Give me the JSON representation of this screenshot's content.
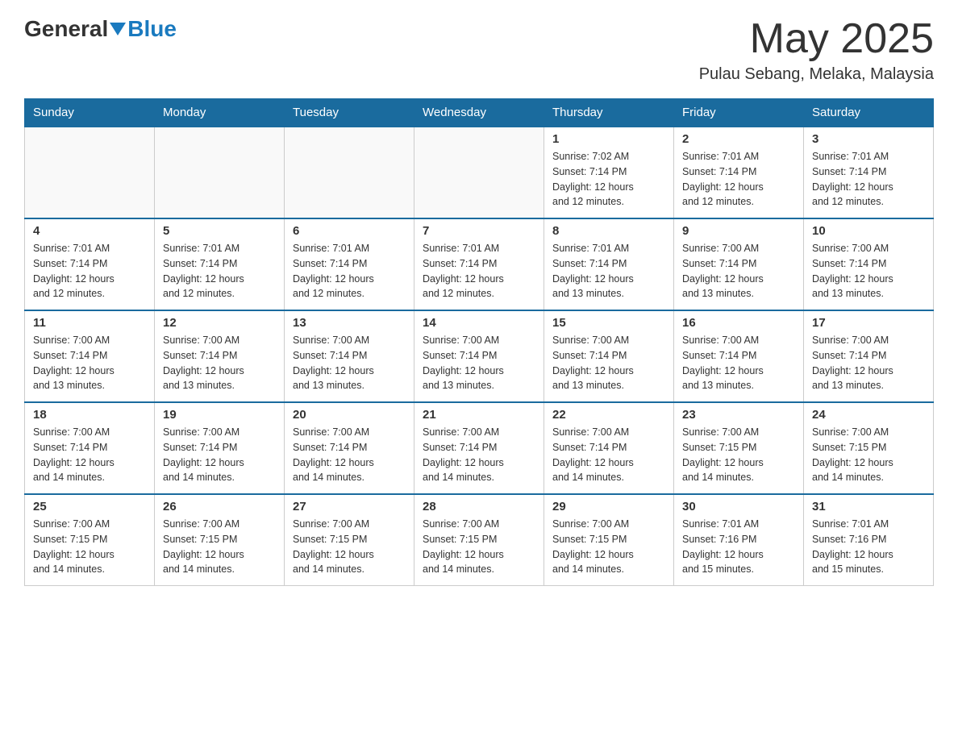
{
  "header": {
    "logo_general": "General",
    "logo_blue": "Blue",
    "month_year": "May 2025",
    "location": "Pulau Sebang, Melaka, Malaysia"
  },
  "days_of_week": [
    "Sunday",
    "Monday",
    "Tuesday",
    "Wednesday",
    "Thursday",
    "Friday",
    "Saturday"
  ],
  "weeks": [
    [
      {
        "day": "",
        "info": ""
      },
      {
        "day": "",
        "info": ""
      },
      {
        "day": "",
        "info": ""
      },
      {
        "day": "",
        "info": ""
      },
      {
        "day": "1",
        "info": "Sunrise: 7:02 AM\nSunset: 7:14 PM\nDaylight: 12 hours\nand 12 minutes."
      },
      {
        "day": "2",
        "info": "Sunrise: 7:01 AM\nSunset: 7:14 PM\nDaylight: 12 hours\nand 12 minutes."
      },
      {
        "day": "3",
        "info": "Sunrise: 7:01 AM\nSunset: 7:14 PM\nDaylight: 12 hours\nand 12 minutes."
      }
    ],
    [
      {
        "day": "4",
        "info": "Sunrise: 7:01 AM\nSunset: 7:14 PM\nDaylight: 12 hours\nand 12 minutes."
      },
      {
        "day": "5",
        "info": "Sunrise: 7:01 AM\nSunset: 7:14 PM\nDaylight: 12 hours\nand 12 minutes."
      },
      {
        "day": "6",
        "info": "Sunrise: 7:01 AM\nSunset: 7:14 PM\nDaylight: 12 hours\nand 12 minutes."
      },
      {
        "day": "7",
        "info": "Sunrise: 7:01 AM\nSunset: 7:14 PM\nDaylight: 12 hours\nand 12 minutes."
      },
      {
        "day": "8",
        "info": "Sunrise: 7:01 AM\nSunset: 7:14 PM\nDaylight: 12 hours\nand 13 minutes."
      },
      {
        "day": "9",
        "info": "Sunrise: 7:00 AM\nSunset: 7:14 PM\nDaylight: 12 hours\nand 13 minutes."
      },
      {
        "day": "10",
        "info": "Sunrise: 7:00 AM\nSunset: 7:14 PM\nDaylight: 12 hours\nand 13 minutes."
      }
    ],
    [
      {
        "day": "11",
        "info": "Sunrise: 7:00 AM\nSunset: 7:14 PM\nDaylight: 12 hours\nand 13 minutes."
      },
      {
        "day": "12",
        "info": "Sunrise: 7:00 AM\nSunset: 7:14 PM\nDaylight: 12 hours\nand 13 minutes."
      },
      {
        "day": "13",
        "info": "Sunrise: 7:00 AM\nSunset: 7:14 PM\nDaylight: 12 hours\nand 13 minutes."
      },
      {
        "day": "14",
        "info": "Sunrise: 7:00 AM\nSunset: 7:14 PM\nDaylight: 12 hours\nand 13 minutes."
      },
      {
        "day": "15",
        "info": "Sunrise: 7:00 AM\nSunset: 7:14 PM\nDaylight: 12 hours\nand 13 minutes."
      },
      {
        "day": "16",
        "info": "Sunrise: 7:00 AM\nSunset: 7:14 PM\nDaylight: 12 hours\nand 13 minutes."
      },
      {
        "day": "17",
        "info": "Sunrise: 7:00 AM\nSunset: 7:14 PM\nDaylight: 12 hours\nand 13 minutes."
      }
    ],
    [
      {
        "day": "18",
        "info": "Sunrise: 7:00 AM\nSunset: 7:14 PM\nDaylight: 12 hours\nand 14 minutes."
      },
      {
        "day": "19",
        "info": "Sunrise: 7:00 AM\nSunset: 7:14 PM\nDaylight: 12 hours\nand 14 minutes."
      },
      {
        "day": "20",
        "info": "Sunrise: 7:00 AM\nSunset: 7:14 PM\nDaylight: 12 hours\nand 14 minutes."
      },
      {
        "day": "21",
        "info": "Sunrise: 7:00 AM\nSunset: 7:14 PM\nDaylight: 12 hours\nand 14 minutes."
      },
      {
        "day": "22",
        "info": "Sunrise: 7:00 AM\nSunset: 7:14 PM\nDaylight: 12 hours\nand 14 minutes."
      },
      {
        "day": "23",
        "info": "Sunrise: 7:00 AM\nSunset: 7:15 PM\nDaylight: 12 hours\nand 14 minutes."
      },
      {
        "day": "24",
        "info": "Sunrise: 7:00 AM\nSunset: 7:15 PM\nDaylight: 12 hours\nand 14 minutes."
      }
    ],
    [
      {
        "day": "25",
        "info": "Sunrise: 7:00 AM\nSunset: 7:15 PM\nDaylight: 12 hours\nand 14 minutes."
      },
      {
        "day": "26",
        "info": "Sunrise: 7:00 AM\nSunset: 7:15 PM\nDaylight: 12 hours\nand 14 minutes."
      },
      {
        "day": "27",
        "info": "Sunrise: 7:00 AM\nSunset: 7:15 PM\nDaylight: 12 hours\nand 14 minutes."
      },
      {
        "day": "28",
        "info": "Sunrise: 7:00 AM\nSunset: 7:15 PM\nDaylight: 12 hours\nand 14 minutes."
      },
      {
        "day": "29",
        "info": "Sunrise: 7:00 AM\nSunset: 7:15 PM\nDaylight: 12 hours\nand 14 minutes."
      },
      {
        "day": "30",
        "info": "Sunrise: 7:01 AM\nSunset: 7:16 PM\nDaylight: 12 hours\nand 15 minutes."
      },
      {
        "day": "31",
        "info": "Sunrise: 7:01 AM\nSunset: 7:16 PM\nDaylight: 12 hours\nand 15 minutes."
      }
    ]
  ]
}
